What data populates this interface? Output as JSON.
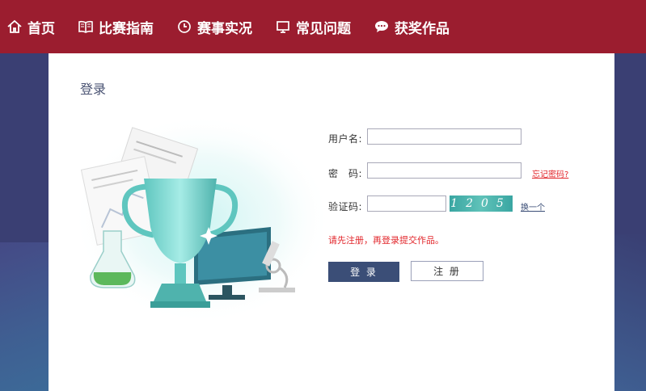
{
  "nav": {
    "items": [
      {
        "label": "首页",
        "icon": "home-icon"
      },
      {
        "label": "比赛指南",
        "icon": "book-icon"
      },
      {
        "label": "赛事实况",
        "icon": "clock-icon"
      },
      {
        "label": "常见问题",
        "icon": "monitor-icon"
      },
      {
        "label": "获奖作品",
        "icon": "chat-icon"
      }
    ],
    "bg_color": "#9b1d2f"
  },
  "login": {
    "title": "登录",
    "username_label": "用户名:",
    "username_value": "",
    "password_label": "密　码:",
    "password_value": "",
    "forgot_link": "忘记密码?",
    "captcha_label": "验证码:",
    "captcha_value": "",
    "captcha_text": "1205",
    "refresh_captcha": "换一个",
    "notice": "请先注册，再登录提交作品。",
    "login_button": "登 录",
    "register_button": "注 册"
  },
  "colors": {
    "accent_red": "#e2262b",
    "button_blue": "#3b4e77",
    "captcha_teal": "#3aa6a2"
  }
}
